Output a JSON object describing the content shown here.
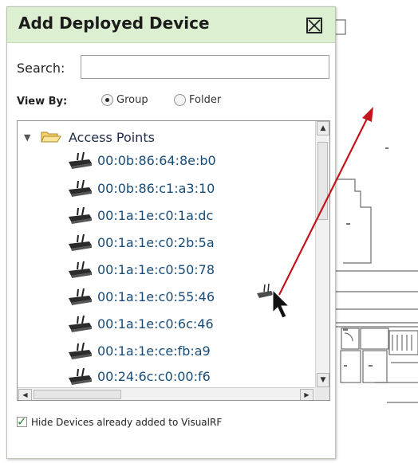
{
  "dialog": {
    "title": "Add Deployed Device",
    "close_icon": "close-box-icon"
  },
  "search": {
    "label": "Search:",
    "value": "",
    "placeholder": ""
  },
  "view_by": {
    "label": "View By:",
    "options": [
      {
        "label": "Group",
        "selected": true
      },
      {
        "label": "Folder",
        "selected": false
      }
    ]
  },
  "tree": {
    "root": {
      "label": "Access Points",
      "expanded": true,
      "icon": "folder-open-icon"
    },
    "items": [
      {
        "mac": "00:0b:86:64:8e:b0",
        "icon": "access-point-icon"
      },
      {
        "mac": "00:0b:86:c1:a3:10",
        "icon": "access-point-icon"
      },
      {
        "mac": "00:1a:1e:c0:1a:dc",
        "icon": "access-point-icon"
      },
      {
        "mac": "00:1a:1e:c0:2b:5a",
        "icon": "access-point-icon"
      },
      {
        "mac": "00:1a:1e:c0:50:78",
        "icon": "access-point-icon"
      },
      {
        "mac": "00:1a:1e:c0:55:46",
        "icon": "access-point-icon"
      },
      {
        "mac": "00:1a:1e:c0:6c:46",
        "icon": "access-point-icon"
      },
      {
        "mac": "00:1a:1e:ce:fb:a9",
        "icon": "access-point-icon"
      },
      {
        "mac": "00:24:6c:c0:00:f6",
        "icon": "access-point-icon"
      }
    ]
  },
  "hide_devices": {
    "label": "Hide Devices already added to VisualRF",
    "checked": true
  },
  "colors": {
    "titlebar": "#dcefd0",
    "mac_text": "#174b78",
    "drag_arrow": "#c4151c"
  }
}
